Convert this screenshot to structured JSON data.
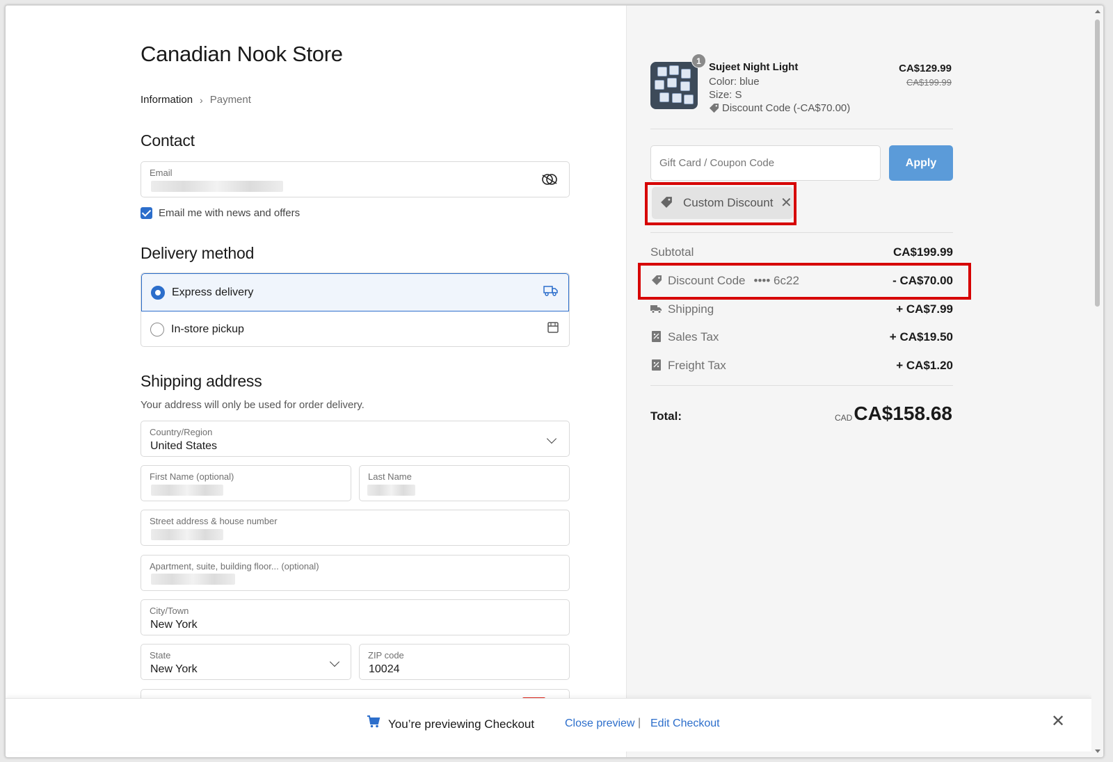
{
  "store": {
    "title": "Canadian Nook Store"
  },
  "breadcrumb": {
    "items": [
      "Information",
      "Payment"
    ],
    "separator": ">"
  },
  "contact": {
    "title": "Contact",
    "email_label": "Email",
    "newsletter_label": "Email me with news and offers"
  },
  "delivery": {
    "title": "Delivery method",
    "options": [
      {
        "label": "Express delivery",
        "selected": true,
        "icon": "truck-icon"
      },
      {
        "label": "In-store pickup",
        "selected": false,
        "icon": "store-icon"
      }
    ]
  },
  "shipping": {
    "title": "Shipping address",
    "subtitle": "Your address will only be used for order delivery.",
    "country_label": "Country/Region",
    "country_value": "United States",
    "first_name_label": "First Name (optional)",
    "last_name_label": "Last Name",
    "street_label": "Street address & house number",
    "apartment_label": "Apartment, suite, building floor... (optional)",
    "city_label": "City/Town",
    "city_value": "New York",
    "state_label": "State",
    "state_value": "New York",
    "zip_label": "ZIP code",
    "zip_value": "10024"
  },
  "cart": {
    "item": {
      "quantity": "1",
      "name": "Sujeet Night Light",
      "color": "Color: blue",
      "size": "Size: S",
      "discount": "Discount Code (-CA$70.00)",
      "price": "CA$129.99",
      "original_price": "CA$199.99"
    },
    "coupon_placeholder": "Gift Card / Coupon Code",
    "apply_label": "Apply",
    "applied_tag": "Custom Discount",
    "lines": [
      {
        "label": "Subtotal",
        "value": "CA$199.99",
        "icon": ""
      },
      {
        "label": "Discount Code",
        "code": "•••• 6c22",
        "value": "- CA$70.00",
        "icon": "tag-icon"
      },
      {
        "label": "Shipping",
        "value": "+ CA$7.99",
        "icon": "truck-icon"
      },
      {
        "label": "Sales Tax",
        "value": "+ CA$19.50",
        "icon": "receipt-icon"
      },
      {
        "label": "Freight Tax",
        "value": "+ CA$1.20",
        "icon": "receipt-icon"
      }
    ],
    "total_label": "Total:",
    "total_currency": "CAD",
    "total_value": "CA$158.68"
  },
  "preview_bar": {
    "message": "You’re previewing Checkout",
    "close_preview": "Close preview",
    "separator": "|",
    "edit_checkout": "Edit Checkout"
  },
  "colors": {
    "accent": "#2c6ecb",
    "apply_button": "#5b9bd9",
    "highlight": "#d60000"
  }
}
